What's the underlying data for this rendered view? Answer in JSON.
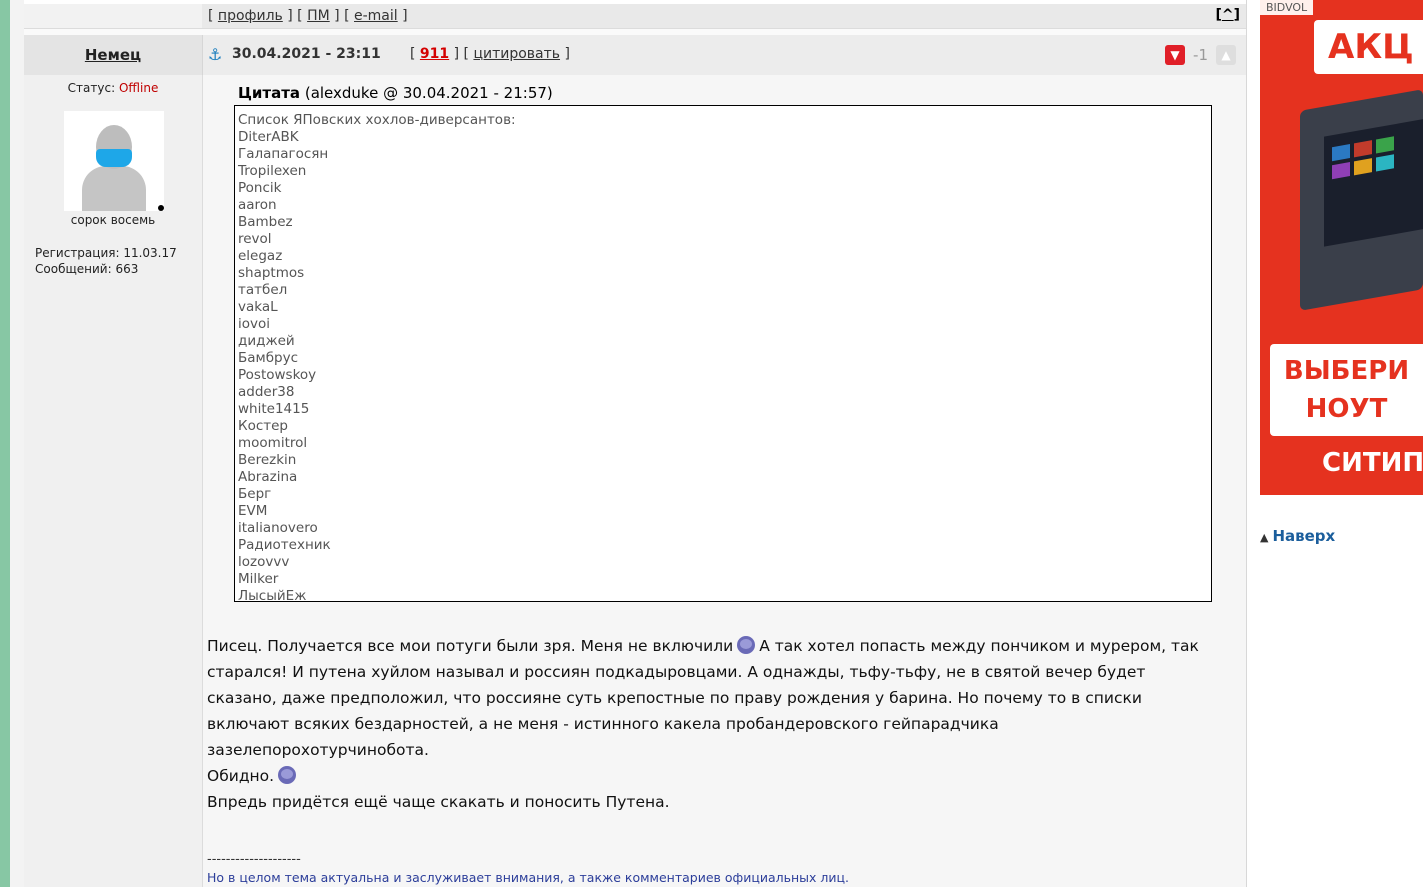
{
  "prev_post": {
    "links": [
      {
        "pre": "[ ",
        "label": "профиль",
        "post": " ]"
      },
      {
        "pre": " [ ",
        "label": "ПМ",
        "post": " ]"
      },
      {
        "pre": " [ ",
        "label": "e-mail",
        "post": " ]"
      }
    ],
    "to_top": "^"
  },
  "post": {
    "author": "Немец",
    "date": "30.04.2021 - 23:11",
    "post_number": "911",
    "quote_label": "цитировать",
    "rating_score": "-1",
    "profile": {
      "status_label": "Статус:",
      "status_value": "Offline",
      "nickname": "сорок восемь",
      "registration": "Регистрация: 11.03.17",
      "messages": "Сообщений: 663"
    },
    "quote": {
      "title": "Цитата",
      "source": "(alexduke @ 30.04.2021 - 21:57)",
      "lines": [
        "Список ЯПовских хохлов-диверсантов:",
        "DiterABK",
        "Галапагосян",
        "Tropilexen",
        "Poncik",
        "aaron",
        "Bambez",
        "revol",
        "elegaz",
        "shaptmos",
        "татбел",
        "vakaL",
        "iovoi",
        "диджей",
        "Бамбрус",
        "Postowskoy",
        "adder38",
        "white1415",
        "Костер",
        "moomitrol",
        "Berezkin",
        "Abrazina",
        "Берг",
        "EVM",
        "italianovero",
        "Радиотехник",
        "lozovvv",
        "Milker",
        "ЛысыйЕж"
      ]
    },
    "text": {
      "p1_a": "Писец. Получается все мои потуги были зря. Меня не включили",
      "p1_b": "А так хотел попасть между пончиком и мурером, так старался! И путена хуйлом называл и россиян подкадыровцами. А однажды, тьфу-тьфу, не в святой вечер будет сказано, даже предположил, что россияне суть крепостные по праву рождения у барина. Но почему то в списки включают всяких бездарностей, а не меня - истинного какела пробандеровского гейпарадчика зазелепорохотурчинобота.",
      "p2": "Обидно.",
      "p3": "Впредь придётся ещё чаще скакать и поносить Путена."
    },
    "signature_line": "--------------------",
    "signature": "Но в целом тема актуальна и заслуживает внимания, а также комментариев официальных лиц."
  },
  "ad": {
    "tag": "BIDVOL",
    "banner1": "АКЦ",
    "banner2_line1": "ВЫБЕРИ",
    "banner2_line2": "НОУТ",
    "banner3": "СИТИП"
  },
  "nav": {
    "to_top": "Наверх"
  },
  "icons": {
    "anchor": "anchor-icon",
    "dislike": "thumbs-down-icon",
    "like": "thumbs-up-icon",
    "smiley": "sad-smiley-icon"
  },
  "colors": {
    "accent_red": "#d40000",
    "ad_red": "#e5321f",
    "link_blue": "#1b5e9c",
    "stripe_green": "#87c7a4"
  }
}
